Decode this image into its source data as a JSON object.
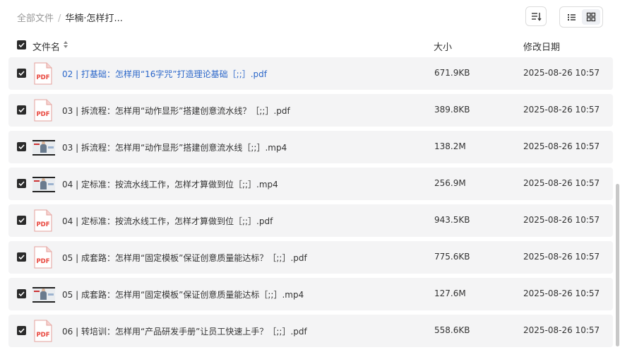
{
  "breadcrumb": {
    "root": "全部文件",
    "separator": "/",
    "current": "华楠·怎样打..."
  },
  "header": {
    "name": "文件名",
    "size": "大小",
    "date": "修改日期"
  },
  "files": [
    {
      "name": "02 | 打基础：怎样用“16字咒”打造理论基础［;;］.pdf",
      "size": "671.9KB",
      "date": "2025-08-26 10:57",
      "type": "pdf",
      "checked": true
    },
    {
      "name": "03 | 拆流程：怎样用“动作显形”搭建创意流水线？［;;］.pdf",
      "size": "389.8KB",
      "date": "2025-08-26 10:57",
      "type": "pdf",
      "checked": true
    },
    {
      "name": "03 | 拆流程：怎样用“动作显形”搭建创意流水线［;;］.mp4",
      "size": "138.2M",
      "date": "2025-08-26 10:57",
      "type": "mp4",
      "checked": true
    },
    {
      "name": "04 | 定标准：按流水线工作，怎样才算做到位［;;］.mp4",
      "size": "256.9M",
      "date": "2025-08-26 10:57",
      "type": "mp4",
      "checked": true
    },
    {
      "name": "04 | 定标准：按流水线工作，怎样才算做到位［;;］.pdf",
      "size": "943.5KB",
      "date": "2025-08-26 10:57",
      "type": "pdf",
      "checked": true
    },
    {
      "name": "05 | 成套路：怎样用“固定模板”保证创意质量能达标？［;;］.pdf",
      "size": "775.6KB",
      "date": "2025-08-26 10:57",
      "type": "pdf",
      "checked": true
    },
    {
      "name": "05 | 成套路：怎样用“固定模板”保证创意质量能达标［;;］.mp4",
      "size": "127.6M",
      "date": "2025-08-26 10:57",
      "type": "mp4",
      "checked": true
    },
    {
      "name": "06 | 转培训：怎样用“产品研发手册”让员工快速上手？［;;］.pdf",
      "size": "558.6KB",
      "date": "2025-08-26 10:57",
      "type": "pdf",
      "checked": true
    }
  ],
  "icons": {
    "pdf_label": "PDF",
    "pdf_color": "#e8453c",
    "link_color": "#2a66c9"
  }
}
